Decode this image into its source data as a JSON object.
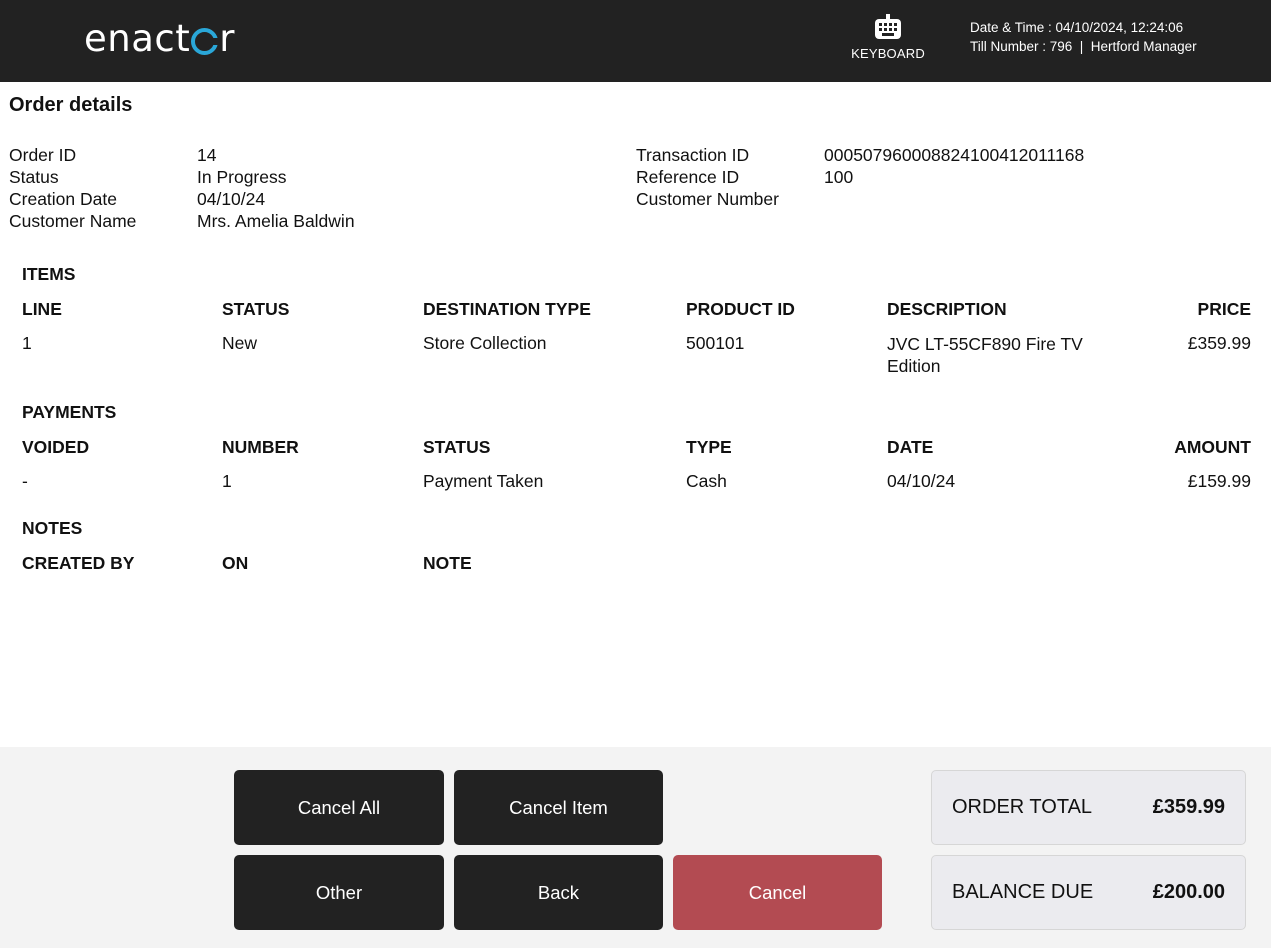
{
  "header": {
    "logo_text": "enactor",
    "keyboard_label": "KEYBOARD",
    "datetime_label": "Date & Time : 04/10/2024, 12:24:06",
    "till_label": "Till Number : 796  |  Hertford Manager"
  },
  "page_title": "Order details",
  "order_info": {
    "left": [
      {
        "label": "Order ID",
        "value": "14"
      },
      {
        "label": "Status",
        "value": "In Progress"
      },
      {
        "label": "Creation Date",
        "value": "04/10/24"
      },
      {
        "label": "Customer Name",
        "value": "Mrs. Amelia Baldwin"
      }
    ],
    "right": [
      {
        "label": "Transaction ID",
        "value": "000507960008824100412011168"
      },
      {
        "label": "Reference ID",
        "value": "100"
      },
      {
        "label": "Customer Number",
        "value": ""
      }
    ]
  },
  "items": {
    "title": "ITEMS",
    "columns": [
      "LINE",
      "STATUS",
      "DESTINATION TYPE",
      "PRODUCT ID",
      "DESCRIPTION",
      "PRICE"
    ],
    "rows": [
      {
        "line": "1",
        "status": "New",
        "destination": "Store Collection",
        "product_id": "500101",
        "description": "JVC LT-55CF890 Fire TV Edition",
        "price": "£359.99"
      }
    ]
  },
  "payments": {
    "title": "PAYMENTS",
    "columns": [
      "VOIDED",
      "NUMBER",
      "STATUS",
      "TYPE",
      "DATE",
      "AMOUNT"
    ],
    "rows": [
      {
        "voided": "-",
        "number": "1",
        "status": "Payment Taken",
        "type": "Cash",
        "date": "04/10/24",
        "amount": "£159.99"
      }
    ]
  },
  "notes": {
    "title": "NOTES",
    "columns": [
      "CREATED BY",
      "ON",
      "NOTE"
    ]
  },
  "buttons": {
    "cancel_all": "Cancel All",
    "cancel_item": "Cancel Item",
    "other": "Other",
    "back": "Back",
    "cancel": "Cancel"
  },
  "totals": {
    "order_total_label": "ORDER TOTAL",
    "order_total_value": "£359.99",
    "balance_due_label": "BALANCE DUE",
    "balance_due_value": "£200.00"
  },
  "colors": {
    "header_bg": "#222222",
    "logo_accent": "#2aa7d8",
    "button_dark": "#222222",
    "button_cancel": "#b34b52",
    "footer_bg": "#f3f3f3",
    "total_box_bg": "#ebebef"
  },
  "icons": {
    "keyboard": "keyboard-icon"
  }
}
